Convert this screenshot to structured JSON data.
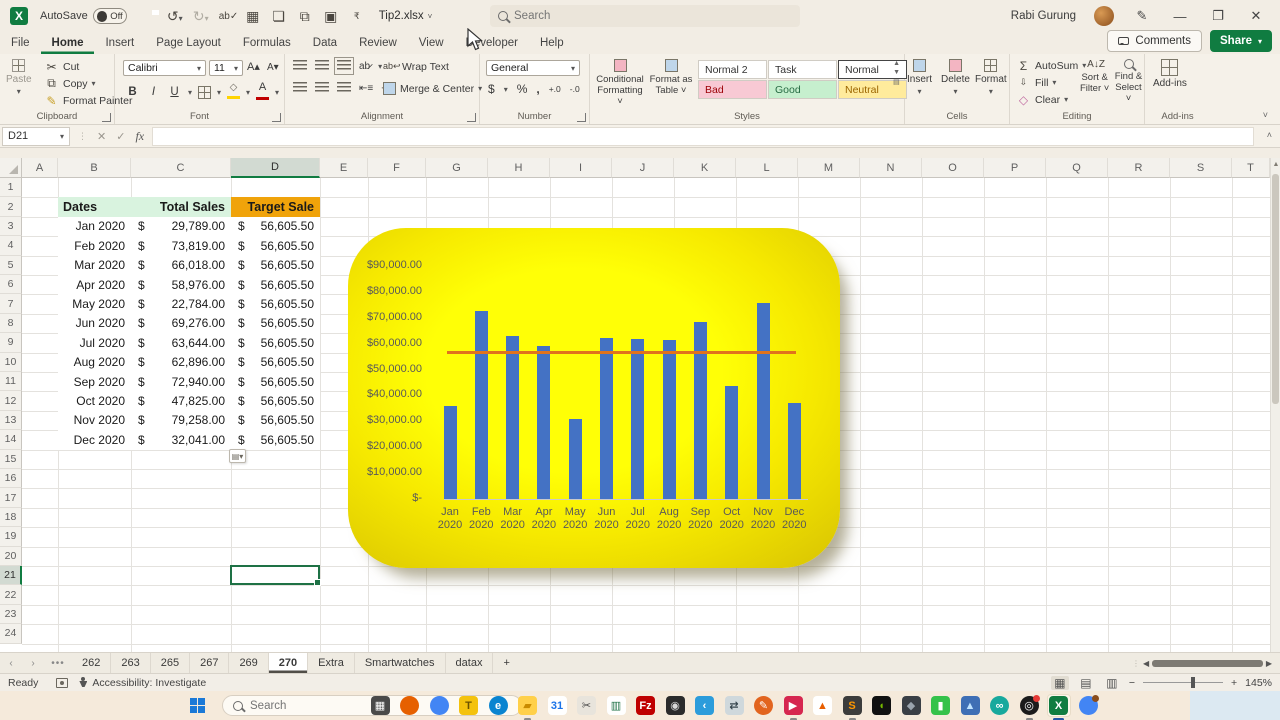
{
  "titlebar": {
    "app_initial": "X",
    "autosave_label": "AutoSave",
    "autosave_state": "Off",
    "filename": "Tip2.xlsx",
    "search_placeholder": "Search",
    "user_name": "Rabi Gurung"
  },
  "menu": {
    "tabs": [
      "File",
      "Home",
      "Insert",
      "Page Layout",
      "Formulas",
      "Data",
      "Review",
      "View",
      "Developer",
      "Help"
    ],
    "active_tab": "Home",
    "comments_label": "Comments",
    "share_label": "Share"
  },
  "ribbon": {
    "clipboard": {
      "label": "Clipboard",
      "paste": "Paste",
      "cut": "Cut",
      "copy": "Copy",
      "format_painter": "Format Painter"
    },
    "font": {
      "label": "Font",
      "name": "Calibri",
      "size": "11"
    },
    "alignment": {
      "label": "Alignment",
      "wrap_text": "Wrap Text",
      "merge_center": "Merge & Center"
    },
    "number": {
      "label": "Number",
      "format": "General"
    },
    "styles": {
      "label": "Styles",
      "conditional_1": "Conditional",
      "conditional_2": "Formatting ˅",
      "format_table_1": "Format as",
      "format_table_2": "Table ˅",
      "gallery": [
        {
          "name": "Normal 2",
          "bg": "#FFFFFF",
          "fg": "#333333",
          "selected": false
        },
        {
          "name": "Task",
          "bg": "#FFFFFF",
          "fg": "#333333",
          "selected": false
        },
        {
          "name": "Normal",
          "bg": "#FFFFFF",
          "fg": "#333333",
          "selected": true
        },
        {
          "name": "Bad",
          "bg": "#F8C9D4",
          "fg": "#9C0006",
          "selected": false
        },
        {
          "name": "Good",
          "bg": "#C6EFCE",
          "fg": "#276B43",
          "selected": false
        },
        {
          "name": "Neutral",
          "bg": "#FFEB9C",
          "fg": "#9C6500",
          "selected": false
        }
      ]
    },
    "cells": {
      "label": "Cells",
      "insert": "Insert",
      "delete": "Delete",
      "format": "Format"
    },
    "editing": {
      "label": "Editing",
      "autosum": "AutoSum",
      "fill": "Fill",
      "clear": "Clear",
      "sort_1": "Sort &",
      "sort_2": "Filter ˅",
      "find_1": "Find &",
      "find_2": "Select ˅"
    },
    "addins": {
      "label": "Add-ins",
      "button": "Add-ins"
    }
  },
  "formula_bar": {
    "cell_ref": "D21",
    "formula": ""
  },
  "grid": {
    "columns": [
      "A",
      "B",
      "C",
      "D",
      "E",
      "F",
      "G",
      "H",
      "I",
      "J",
      "K",
      "L",
      "M",
      "N",
      "O",
      "P",
      "Q",
      "R",
      "S",
      "T"
    ],
    "row_numbers": [
      1,
      2,
      3,
      4,
      5,
      6,
      7,
      8,
      9,
      10,
      11,
      12,
      13,
      14,
      15,
      16,
      17,
      18,
      19,
      20,
      21,
      22,
      23,
      24
    ],
    "selected_cell": "D21",
    "selected_column": "D",
    "selected_row": 21,
    "table": {
      "currency_symbol": "$",
      "headers": {
        "dates": "Dates",
        "total": "Total Sales",
        "target": "Target Sale"
      },
      "header_colors": {
        "dates_bg": "#D9F3DF",
        "total_bg": "#D9F3DF",
        "target_bg": "#F0A30A"
      },
      "rows": [
        {
          "date": "Jan 2020",
          "total": "29,789.00",
          "target": "56,605.50"
        },
        {
          "date": "Feb 2020",
          "total": "73,819.00",
          "target": "56,605.50"
        },
        {
          "date": "Mar 2020",
          "total": "66,018.00",
          "target": "56,605.50"
        },
        {
          "date": "Apr 2020",
          "total": "58,976.00",
          "target": "56,605.50"
        },
        {
          "date": "May 2020",
          "total": "22,784.00",
          "target": "56,605.50"
        },
        {
          "date": "Jun 2020",
          "total": "69,276.00",
          "target": "56,605.50"
        },
        {
          "date": "Jul 2020",
          "total": "63,644.00",
          "target": "56,605.50"
        },
        {
          "date": "Aug 2020",
          "total": "62,896.00",
          "target": "56,605.50"
        },
        {
          "date": "Sep 2020",
          "total": "72,940.00",
          "target": "56,605.50"
        },
        {
          "date": "Oct 2020",
          "total": "47,825.00",
          "target": "56,605.50"
        },
        {
          "date": "Nov 2020",
          "total": "79,258.00",
          "target": "56,605.50"
        },
        {
          "date": "Dec 2020",
          "total": "32,041.00",
          "target": "56,605.50"
        }
      ]
    }
  },
  "chart_data": {
    "type": "bar",
    "title": "",
    "categories": [
      "Jan 2020",
      "Feb 2020",
      "Mar 2020",
      "Apr 2020",
      "May 2020",
      "Jun 2020",
      "Jul 2020",
      "Aug 2020",
      "Sep 2020",
      "Oct 2020",
      "Nov 2020",
      "Dec 2020"
    ],
    "series": [
      {
        "name": "Total Sales",
        "type": "bar",
        "color": "#4472C4",
        "values": [
          36000,
          72600,
          63000,
          59000,
          30800,
          62200,
          61800,
          61400,
          68400,
          43800,
          75900,
          37200
        ]
      },
      {
        "name": "Target Sale",
        "type": "line",
        "color": "#E0731D",
        "value": 56605.5
      }
    ],
    "ylim": [
      0,
      90000
    ],
    "yticks": [
      "$90,000.00",
      "$80,000.00",
      "$70,000.00",
      "$60,000.00",
      "$50,000.00",
      "$40,000.00",
      "$30,000.00",
      "$20,000.00",
      "$10,000.00",
      "$-"
    ],
    "legend": "none",
    "grid": false,
    "background": {
      "style": "radial yellow gradient",
      "center": "#FFFF06",
      "edge": "#DCC802"
    }
  },
  "sheet_bar": {
    "tabs": [
      "262",
      "263",
      "265",
      "267",
      "269",
      "270",
      "Extra",
      "Smartwatches",
      "datax"
    ],
    "active_tab": "270",
    "add_label": "+"
  },
  "status_bar": {
    "ready": "Ready",
    "accessibility": "Accessibility: Investigate",
    "zoom": "145%"
  },
  "taskbar": {
    "search_placeholder": "Search",
    "icons": [
      {
        "name": "task-view",
        "glyph": "▦",
        "bg": "#4a4a4a",
        "fg": "#ffffff",
        "circle": false,
        "running": false
      },
      {
        "name": "firefox",
        "glyph": "",
        "bg": "#E66000",
        "fg": "#ffffff",
        "circle": true,
        "running": false
      },
      {
        "name": "chrome",
        "glyph": "",
        "bg": "#4285F4",
        "fg": "#ffffff",
        "circle": true,
        "running": false
      },
      {
        "name": "translator",
        "glyph": "T",
        "bg": "#F4C20D",
        "fg": "#6b5200",
        "circle": false,
        "running": false
      },
      {
        "name": "edge",
        "glyph": "e",
        "bg": "#0A84D0",
        "fg": "#ffffff",
        "circle": true,
        "running": false
      },
      {
        "name": "file-explorer",
        "glyph": "▰",
        "bg": "#FFD04A",
        "fg": "#c98b00",
        "circle": false,
        "running": true
      },
      {
        "name": "calendar",
        "glyph": "31",
        "bg": "#ffffff",
        "fg": "#1a73e8",
        "circle": false,
        "running": false
      },
      {
        "name": "snipping-tool",
        "glyph": "✂",
        "bg": "#e8e4dc",
        "fg": "#444444",
        "circle": false,
        "running": false
      },
      {
        "name": "chart-app",
        "glyph": "▥",
        "bg": "#ffffff",
        "fg": "#1e7145",
        "circle": false,
        "running": false
      },
      {
        "name": "filezilla",
        "glyph": "Fz",
        "bg": "#BF0000",
        "fg": "#ffffff",
        "circle": false,
        "running": false
      },
      {
        "name": "contacts",
        "glyph": "◉",
        "bg": "#2b2b2b",
        "fg": "#d8d8d8",
        "circle": false,
        "running": false
      },
      {
        "name": "vscode",
        "glyph": "‹",
        "bg": "#2C9CDB",
        "fg": "#ffffff",
        "circle": false,
        "running": false
      },
      {
        "name": "remote-desktop",
        "glyph": "⇄",
        "bg": "#cfd8dc",
        "fg": "#37474f",
        "circle": false,
        "running": false
      },
      {
        "name": "pen-app",
        "glyph": "✎",
        "bg": "#E2641E",
        "fg": "#ffffff",
        "circle": true,
        "running": false
      },
      {
        "name": "video-app",
        "glyph": "▶",
        "bg": "#D6264F",
        "fg": "#ffffff",
        "circle": false,
        "running": true
      },
      {
        "name": "vlc",
        "glyph": "▲",
        "bg": "#ffffff",
        "fg": "#E85E00",
        "circle": false,
        "running": false
      },
      {
        "name": "sublime-text",
        "glyph": "S",
        "bg": "#3c3c3c",
        "fg": "#FF9800",
        "circle": false,
        "running": true
      },
      {
        "name": "nvidia",
        "glyph": "◖",
        "bg": "#111111",
        "fg": "#76B900",
        "circle": false,
        "running": false
      },
      {
        "name": "dark-app",
        "glyph": "◆",
        "bg": "#3a3f45",
        "fg": "#9aa4ad",
        "circle": false,
        "running": false
      },
      {
        "name": "green-app",
        "glyph": "▮",
        "bg": "#35C24A",
        "fg": "#ffffff",
        "circle": false,
        "running": false
      },
      {
        "name": "photos-app",
        "glyph": "▲",
        "bg": "#3f6fb5",
        "fg": "#bfe3ff",
        "circle": false,
        "running": false
      },
      {
        "name": "camtasia",
        "glyph": "∞",
        "bg": "#18A99D",
        "fg": "#ffffff",
        "circle": true,
        "running": false
      },
      {
        "name": "obs-studio",
        "glyph": "◎",
        "bg": "#1b1b1b",
        "fg": "#ffffff",
        "circle": true,
        "running": true,
        "dot": "#E53935"
      },
      {
        "name": "excel",
        "glyph": "X",
        "bg": "#107C41",
        "fg": "#ffffff",
        "circle": false,
        "running": true,
        "active": true
      },
      {
        "name": "chrome-profile",
        "glyph": "",
        "bg": "#4285F4",
        "fg": "#ffffff",
        "circle": true,
        "running": false,
        "dot": "#8a4d1c"
      }
    ]
  }
}
